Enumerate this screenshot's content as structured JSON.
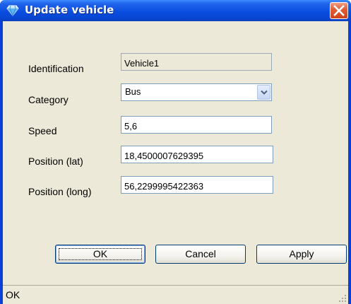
{
  "window": {
    "title": "Update vehicle",
    "title_icon": "diamond-icon",
    "close_icon": "close-icon"
  },
  "form": {
    "identification": {
      "label": "Identification",
      "value": "Vehicle1"
    },
    "category": {
      "label": "Category",
      "value": "Bus"
    },
    "speed": {
      "label": "Speed",
      "value": "5,6"
    },
    "position_lat": {
      "label": "Position (lat)",
      "value": "18,4500007629395"
    },
    "position_long": {
      "label": "Position (long)",
      "value": "56,2299995422363"
    }
  },
  "buttons": {
    "ok": "OK",
    "cancel": "Cancel",
    "apply": "Apply"
  },
  "status": {
    "text": "OK"
  },
  "colors": {
    "titlebar": "#0a4ee0",
    "close": "#d0431b",
    "client": "#ece9d8",
    "field_border": "#7f9db9"
  }
}
